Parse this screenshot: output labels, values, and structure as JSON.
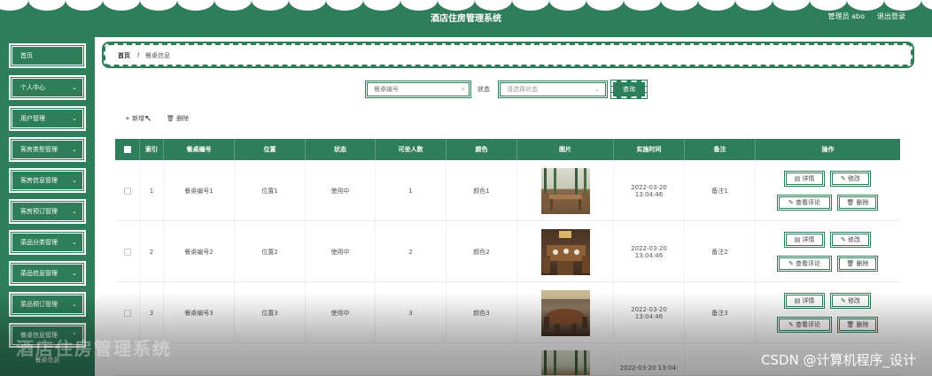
{
  "header": {
    "title": "酒店住房管理系统",
    "user": "管理员 abo",
    "logout": "退出登录"
  },
  "sidebar": {
    "items": [
      {
        "label": "首页",
        "has_chevron": false
      },
      {
        "label": "个人中心",
        "has_chevron": true
      },
      {
        "label": "用户管理",
        "has_chevron": true
      },
      {
        "label": "客房类型管理",
        "has_chevron": true
      },
      {
        "label": "客房信息管理",
        "has_chevron": true
      },
      {
        "label": "客房预订管理",
        "has_chevron": true
      },
      {
        "label": "菜品分类管理",
        "has_chevron": true
      },
      {
        "label": "菜品信息管理",
        "has_chevron": true
      },
      {
        "label": "菜品预订管理",
        "has_chevron": true
      },
      {
        "label": "餐桌信息管理",
        "has_chevron": true
      }
    ],
    "sub_item": "餐桌信息"
  },
  "breadcrumb": {
    "home": "首页",
    "sep": "/",
    "current": "餐桌信息"
  },
  "search": {
    "placeholder": "餐桌编号",
    "status_label": "状态",
    "status_placeholder": "请选择状态",
    "query_button": "查询"
  },
  "toolbar": {
    "add": "+ 新增",
    "delete": "删除"
  },
  "table": {
    "headers": [
      "索引",
      "餐桌编号",
      "位置",
      "状态",
      "可坐人数",
      "颜色",
      "图片",
      "实施时间",
      "备注",
      "操作"
    ],
    "rows": [
      {
        "index": "1",
        "code": "餐桌编号1",
        "location": "位置1",
        "status": "使用中",
        "seats": "1",
        "color": "颜色1",
        "time": "2022-03-20 13:04:46",
        "note": "备注1"
      },
      {
        "index": "2",
        "code": "餐桌编号2",
        "location": "位置2",
        "status": "使用中",
        "seats": "2",
        "color": "颜色2",
        "time": "2022-03-20 13:04:46",
        "note": "备注2"
      },
      {
        "index": "3",
        "code": "餐桌编号3",
        "location": "位置3",
        "status": "使用中",
        "seats": "3",
        "color": "颜色3",
        "time": "2022-03-20 13:04:46",
        "note": "备注3"
      },
      {
        "index": "",
        "code": "",
        "location": "",
        "status": "",
        "seats": "",
        "color": "",
        "time": "2022-03-20 13:04:",
        "note": ""
      }
    ],
    "actions": {
      "detail": "详情",
      "edit": "修改",
      "review": "查看评论",
      "remove": "删除"
    }
  },
  "overlay": {
    "watermark": "CSDN @计算机程序_设计",
    "ghost_text": "酒店住房管理系统"
  },
  "colors": {
    "primary": "#2e7d5b",
    "white": "#ffffff"
  }
}
